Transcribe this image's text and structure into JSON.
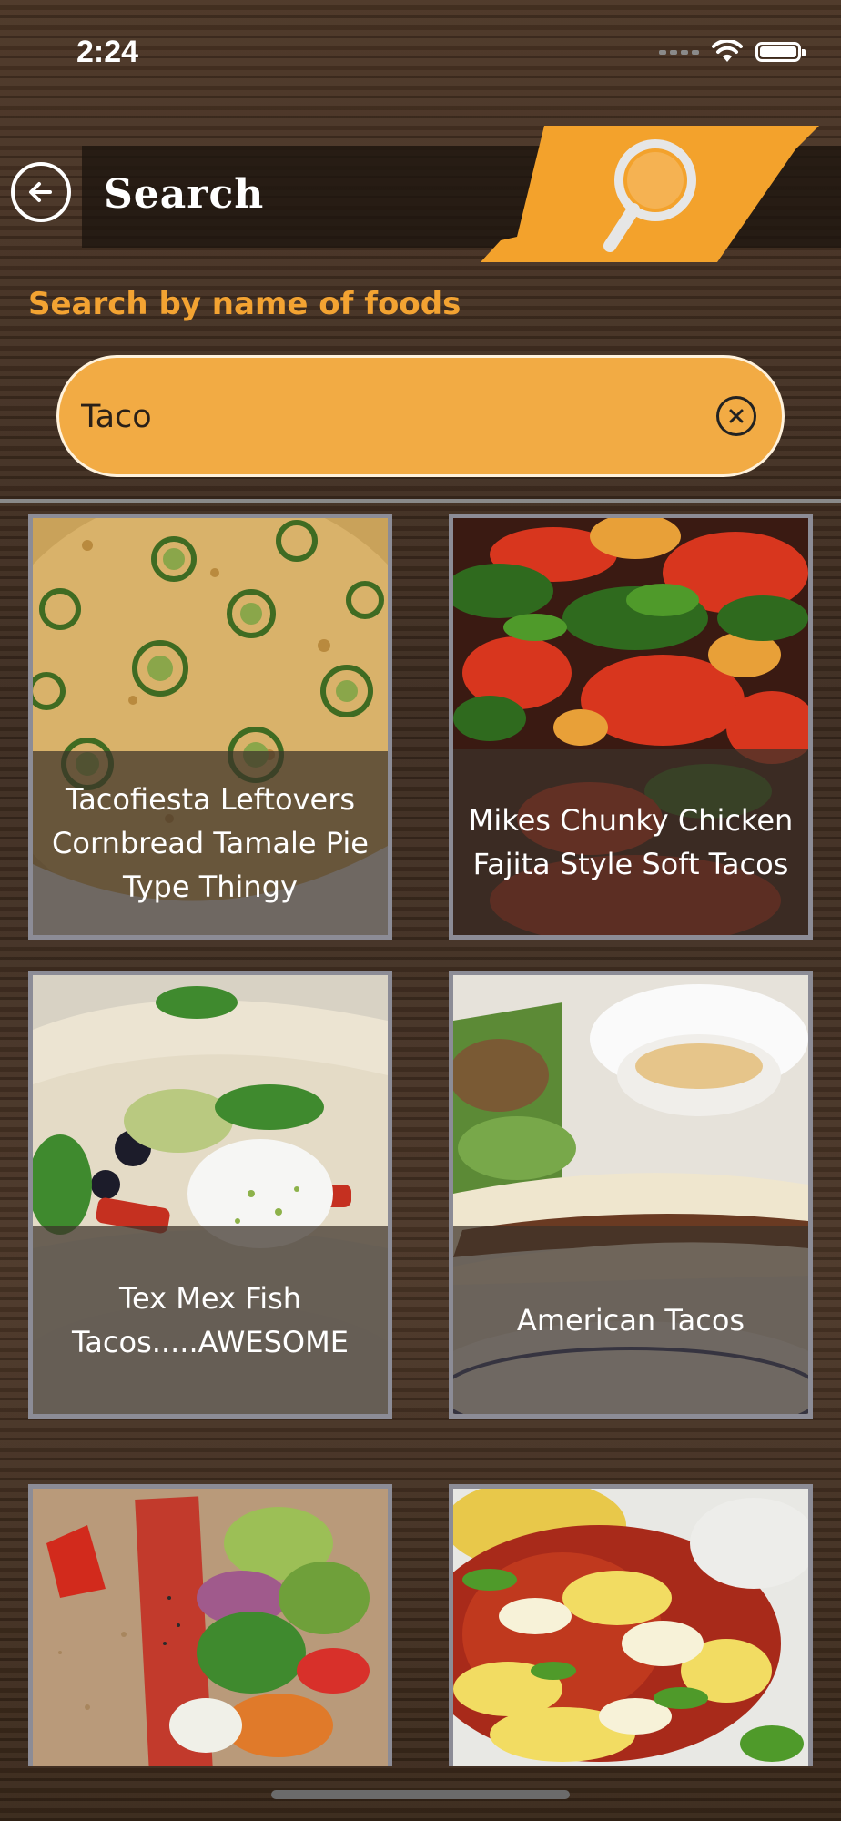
{
  "status": {
    "time": "2:24",
    "signal_icon": "signal-bars-icon",
    "wifi_icon": "wifi-icon",
    "battery_icon": "battery-icon"
  },
  "header": {
    "title": "Search",
    "back_icon": "back-arrow-icon",
    "badge_icon": "magnifier-icon",
    "accent": "#f3a22c"
  },
  "search": {
    "hint": "Search by name of foods",
    "value": "Taco",
    "clear_icon": "clear-circle-icon",
    "field_color": "#f2ab44"
  },
  "results": [
    {
      "caption": "Tacofiesta Leftovers Cornbread Tamale Pie Type Thingy"
    },
    {
      "caption": "Mikes Chunky Chicken Fajita Style Soft Tacos"
    },
    {
      "caption": "Tex Mex Fish Tacos.....AWESOME"
    },
    {
      "caption": "American Tacos"
    },
    {
      "caption": ""
    },
    {
      "caption": ""
    }
  ]
}
